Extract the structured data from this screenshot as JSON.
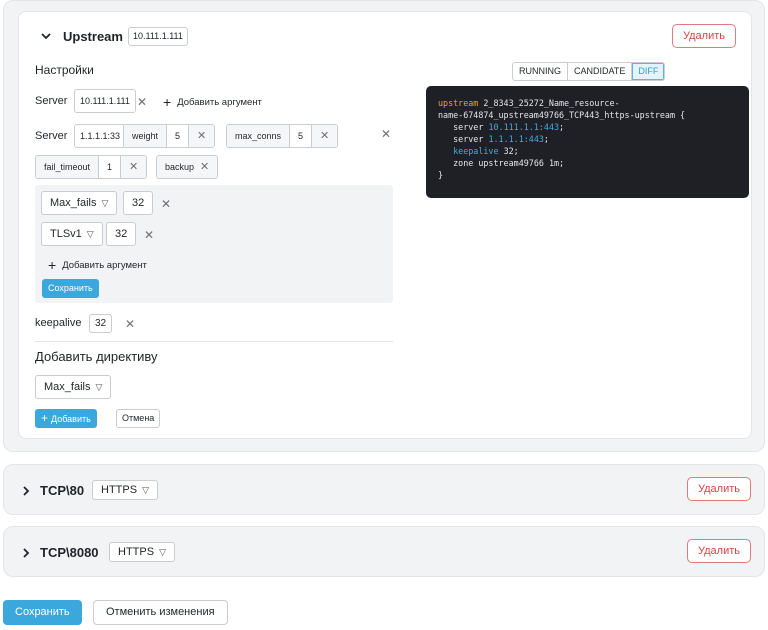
{
  "upstream": {
    "title": "Upstream",
    "address_tag": "10.111.1.111",
    "delete_label": "Удалить",
    "settings_label": "Настройки",
    "view_modes": [
      "RUNNING",
      "CANDIDATE",
      "DIFF"
    ],
    "active_view_mode": "DIFF",
    "config_lines": {
      "l1_kw": "upstream",
      "l1_rest": " 2_8343_25272_Name_resource-",
      "l2": "name-674874_upstream49766_TCP443_https-upstream {",
      "l3_kw": "server",
      "l3_ip": "10.111.1.1:443",
      "l4_kw": "server",
      "l4_ip": "1.1.1.1:443",
      "l5_kw": "keepalive",
      "l5_val": "32;",
      "l6": "zone upstream49766 1m;",
      "l7": "}"
    },
    "server1": {
      "label": "Server",
      "address": "10.111.1.111",
      "add_argument": "Добавить аргумент"
    },
    "server2": {
      "label": "Server",
      "address": "1.1.1.1:33",
      "weight_label": "weight",
      "weight_value": "5",
      "max_conns_label": "max_conns",
      "max_conns_value": "5",
      "fail_timeout_label": "fail_timeout",
      "fail_timeout_value": "1",
      "backup_label": "backup"
    },
    "editor": {
      "param1_name": "Max_fails",
      "param1_value": "32",
      "param2_name": "TLSv1",
      "param2_value": "32",
      "add_argument": "Добавить аргумент",
      "save_label": "Сохранить"
    },
    "keepalive": {
      "label": "keepalive",
      "value": "32"
    },
    "add_directive": {
      "title": "Добавить директиву",
      "selected": "Max_fails",
      "add_label": "Добавить",
      "cancel_label": "Отмена"
    }
  },
  "tcp80": {
    "title": "TCP\\80",
    "protocol": "HTTPS",
    "delete_label": "Удалить"
  },
  "tcp8080": {
    "title": "TCP\\8080",
    "protocol": "HTTPS",
    "delete_label": "Удалить"
  },
  "footer": {
    "save_label": "Сохранить",
    "cancel_label": "Отменить изменения"
  },
  "colors": {
    "accent": "#3aa8dc",
    "danger": "#d64545",
    "code_bg": "#1e2026",
    "code_keyword": "#e8a33c",
    "code_ip": "#4aa6e0"
  }
}
